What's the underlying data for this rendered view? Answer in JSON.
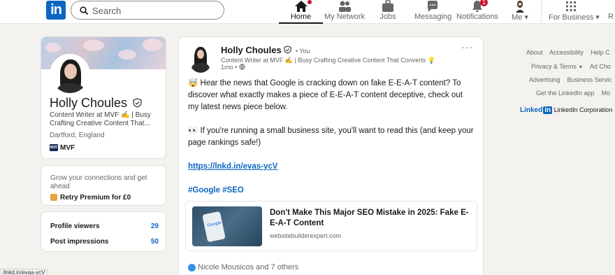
{
  "nav": {
    "logo": "in",
    "search_placeholder": "Search",
    "items": [
      {
        "label": "Home",
        "badge": ""
      },
      {
        "label": "My Network",
        "badge": ""
      },
      {
        "label": "Jobs",
        "badge": ""
      },
      {
        "label": "Messaging",
        "badge": ""
      },
      {
        "label": "Notifications",
        "badge": "1"
      },
      {
        "label": "Me",
        "badge": ""
      },
      {
        "label": "For Business",
        "badge": ""
      },
      {
        "label": "R",
        "badge": ""
      }
    ]
  },
  "profile": {
    "name": "Holly Choules",
    "headline": "Content Writer at MVF ✍️ | Busy Crafting Creative Content That...",
    "location": "Dartford, England",
    "company": "MVF",
    "company_logo_text": "MVF"
  },
  "premium": {
    "text": "Grow your connections and get ahead",
    "cta": "Retry Premium for £0"
  },
  "stats": [
    {
      "label": "Profile viewers",
      "value": "29"
    },
    {
      "label": "Post impressions",
      "value": "50"
    }
  ],
  "post": {
    "author": "Holly Choules",
    "degree": "• You",
    "headline": "Content Writer at MVF ✍️ | Busy Crafting Creative Content That Converts 💡",
    "time": "1mo •",
    "more": "···",
    "para1": "🤯 Hear the news that Google is cracking down on fake E-E-A-T content? To discover what exactly makes a piece of E-E-A-T content deceptive, check out my latest news piece below.",
    "para2": "👀 If you're running a small business site, you'll want to read this (and keep your page rankings safe!)",
    "link": "https://lnkd.in/evas-ycV",
    "hashtags": "#Google #SEO",
    "article_title": "Don't Make This Major SEO Mistake in 2025: Fake E-E-A-T Content",
    "article_source": "websitebuilderexpert.com",
    "article_thumb_text": "Google",
    "reactions": "Nicole Mousicos and 7 others"
  },
  "footer": {
    "row1": [
      "About",
      "Accessibility",
      "Help C"
    ],
    "row2a": "Privacy & Terms",
    "row2b": "Ad Cho",
    "row3": [
      "Advertising",
      "Business Servic"
    ],
    "row4a": "Get the LinkedIn app",
    "row4b": "Mo",
    "brand_a": "Linked",
    "brand_b": "in",
    "brand_text": "LinkedIn Corporation"
  },
  "status_url": "/lnkd.in/evas-ycV",
  "colors": {
    "brand": "#0a66c2",
    "badge": "#cb112d",
    "bg": "#f4f2ee"
  }
}
